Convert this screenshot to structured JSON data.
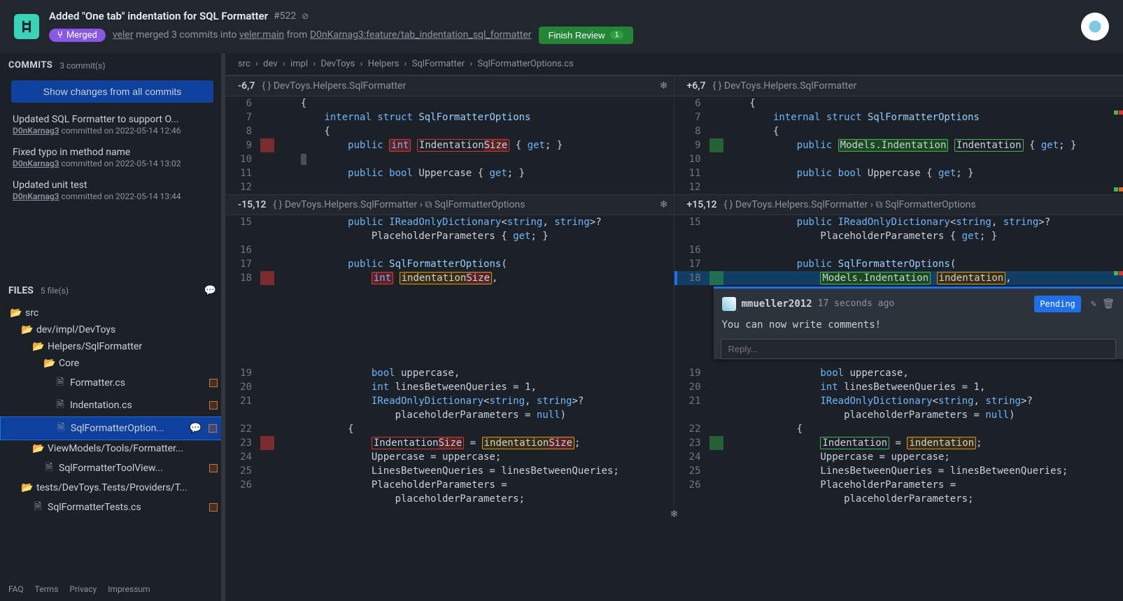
{
  "header": {
    "title": "Added \"One tab\" indentation for SQL Formatter",
    "number": "#522",
    "merged": "Merged",
    "mergedBy": "veler",
    "mergeText1": "merged 3 commits into",
    "targetRef": "veler:main",
    "mergeText2": "from",
    "sourceRef": "D0nKarnag3:feature/tab_indentation_sql_formatter",
    "finishReview": "Finish Review",
    "reviewCount": "1"
  },
  "commitsSection": {
    "label": "COMMITS",
    "meta": "3 commit(s)",
    "showAll": "Show changes from all commits"
  },
  "commits": [
    {
      "msg": "Updated SQL Formatter to support O...",
      "author": "D0nKarnag3",
      "when": "committed on 2022-05-14 12:46"
    },
    {
      "msg": "Fixed typo in method name",
      "author": "D0nKarnag3",
      "when": "committed on 2022-05-14 13:02"
    },
    {
      "msg": "Updated unit test",
      "author": "D0nKarnag3",
      "when": "committed on 2022-05-14 13:44"
    }
  ],
  "filesSection": {
    "label": "FILES",
    "meta": "5 file(s)"
  },
  "tree": [
    {
      "depth": 0,
      "icon": "📂",
      "nm": "src",
      "dot": false
    },
    {
      "depth": 1,
      "icon": "📂",
      "nm": "dev/impl/DevToys",
      "dot": false
    },
    {
      "depth": 2,
      "icon": "📂",
      "nm": "Helpers/SqlFormatter",
      "dot": false
    },
    {
      "depth": 3,
      "icon": "📂",
      "nm": "Core",
      "dot": false
    },
    {
      "depth": 4,
      "icon": "🗎",
      "nm": "Formatter.cs",
      "dot": true
    },
    {
      "depth": 4,
      "icon": "🗎",
      "nm": "Indentation.cs",
      "dot": true
    },
    {
      "depth": 4,
      "icon": "🗎",
      "nm": "SqlFormatterOption...",
      "dot": true,
      "active": true,
      "chat": true
    },
    {
      "depth": 2,
      "icon": "📂",
      "nm": "ViewModels/Tools/Formatter...",
      "dot": false
    },
    {
      "depth": 3,
      "icon": "🗎",
      "nm": "SqlFormatterToolView...",
      "dot": true
    },
    {
      "depth": 1,
      "icon": "📂",
      "nm": "tests/DevToys.Tests/Providers/T...",
      "dot": false
    },
    {
      "depth": 2,
      "icon": "🗎",
      "nm": "SqlFormatterTests.cs",
      "dot": true
    }
  ],
  "footer": [
    "FAQ",
    "Terms",
    "Privacy",
    "Impressum"
  ],
  "breadcrumb": [
    "src",
    "dev",
    "impl",
    "DevToys",
    "Helpers",
    "SqlFormatter",
    "SqlFormatterOptions.cs"
  ],
  "hunk1": {
    "left": "-6,7",
    "right": "+6,7",
    "ctx": "DevToys.Helpers.SqlFormatter"
  },
  "hunk2": {
    "left": "-15,12",
    "right": "+15,12",
    "ctx": "DevToys.Helpers.SqlFormatter",
    "sub": "SqlFormatterOptions"
  },
  "comment": {
    "author": "mmueller2012",
    "when": "17 seconds ago",
    "pending": "Pending",
    "body": "You can now write comments!",
    "replyPh": "Reply..."
  }
}
